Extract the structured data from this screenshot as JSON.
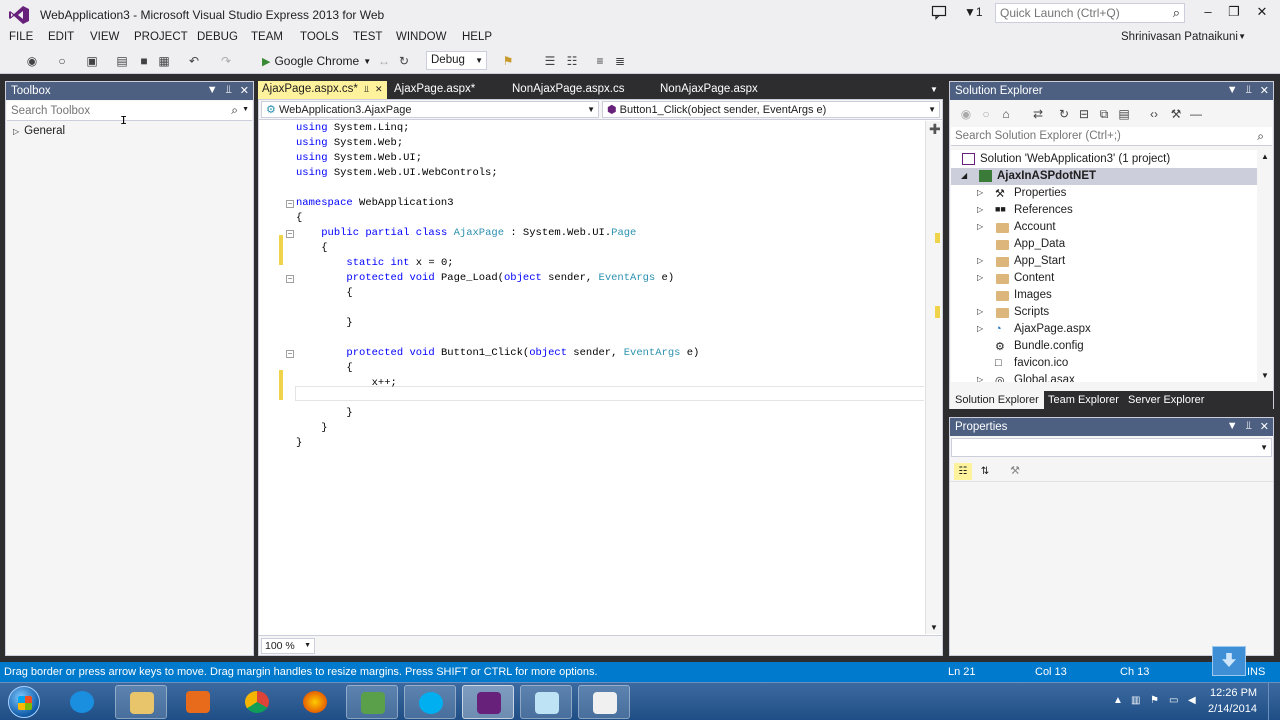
{
  "window": {
    "title": "WebApplication3 - Microsoft Visual Studio Express 2013 for Web",
    "feedback_count": "1",
    "quick_launch_placeholder": "Quick Launch (Ctrl+Q)"
  },
  "menu": {
    "items": [
      "FILE",
      "EDIT",
      "VIEW",
      "PROJECT",
      "DEBUG",
      "TEAM",
      "TOOLS",
      "TEST",
      "WINDOW",
      "HELP"
    ],
    "user": "Shrinivasan Patnaikuni"
  },
  "toolbar": {
    "run_target": "Google Chrome",
    "configuration": "Debug"
  },
  "toolbox": {
    "title": "Toolbox",
    "search_placeholder": "Search Toolbox",
    "group": "General"
  },
  "doc_tabs": [
    {
      "label": "AjaxPage.aspx.cs*",
      "active": true
    },
    {
      "label": "AjaxPage.aspx*",
      "active": false
    },
    {
      "label": "NonAjaxPage.aspx.cs",
      "active": false
    },
    {
      "label": "NonAjaxPage.aspx",
      "active": false
    }
  ],
  "editor": {
    "nav_class": "WebApplication3.AjaxPage",
    "nav_member": "Button1_Click(object sender, EventArgs e)",
    "zoom": "100 %",
    "code_lines": [
      "using System.Linq;",
      "using System.Web;",
      "using System.Web.UI;",
      "using System.Web.UI.WebControls;",
      "",
      "namespace WebApplication3",
      "{",
      "    public partial class AjaxPage : System.Web.UI.Page",
      "    {",
      "        static int x = 0;",
      "        protected void Page_Load(object sender, EventArgs e)",
      "        {",
      "",
      "        }",
      "",
      "        protected void Button1_Click(object sender, EventArgs e)",
      "        {",
      "            x++;",
      "",
      "        }",
      "    }",
      "}"
    ]
  },
  "solution_explorer": {
    "title": "Solution Explorer",
    "search_placeholder": "Search Solution Explorer (Ctrl+;)",
    "items": [
      {
        "label": "Solution 'WebApplication3' (1 project)",
        "icon": "solution-icon"
      },
      {
        "label": "AjaxInASPdotNET",
        "icon": "web-project-icon"
      },
      {
        "label": "Properties",
        "icon": "wrench-icon"
      },
      {
        "label": "References",
        "icon": "references-icon"
      },
      {
        "label": "Account",
        "icon": "folder-icon"
      },
      {
        "label": "App_Data",
        "icon": "folder-icon"
      },
      {
        "label": "App_Start",
        "icon": "folder-icon"
      },
      {
        "label": "Content",
        "icon": "folder-icon"
      },
      {
        "label": "Images",
        "icon": "folder-icon"
      },
      {
        "label": "Scripts",
        "icon": "folder-icon"
      },
      {
        "label": "AjaxPage.aspx",
        "icon": "aspx-file-icon"
      },
      {
        "label": "Bundle.config",
        "icon": "config-file-icon"
      },
      {
        "label": "favicon.ico",
        "icon": "image-file-icon"
      },
      {
        "label": "Global.asax",
        "icon": "asax-file-icon"
      }
    ],
    "bottom_tabs": [
      "Solution Explorer",
      "Team Explorer",
      "Server Explorer"
    ]
  },
  "properties": {
    "title": "Properties"
  },
  "status_bar": {
    "message": "Drag border or press arrow keys to move. Drag margin handles to resize margins. Press SHIFT or CTRL for more options.",
    "line": "Ln 21",
    "col": "Col 13",
    "ch": "Ch 13",
    "mode": "INS"
  },
  "taskbar": {
    "time": "12:26 PM",
    "date": "2/14/2014",
    "apps": [
      "internet-explorer-icon",
      "file-explorer-icon",
      "media-player-icon",
      "chrome-icon",
      "firefox-icon",
      "spreadsheet-icon",
      "skype-icon",
      "visual-studio-icon",
      "app-icon",
      "window-icon"
    ]
  },
  "colors": {
    "status_bar": "#007acc",
    "pane_header": "#4d6082",
    "active_tab": "#fff29d",
    "keyword": "#0000ff",
    "type": "#2b91af"
  }
}
